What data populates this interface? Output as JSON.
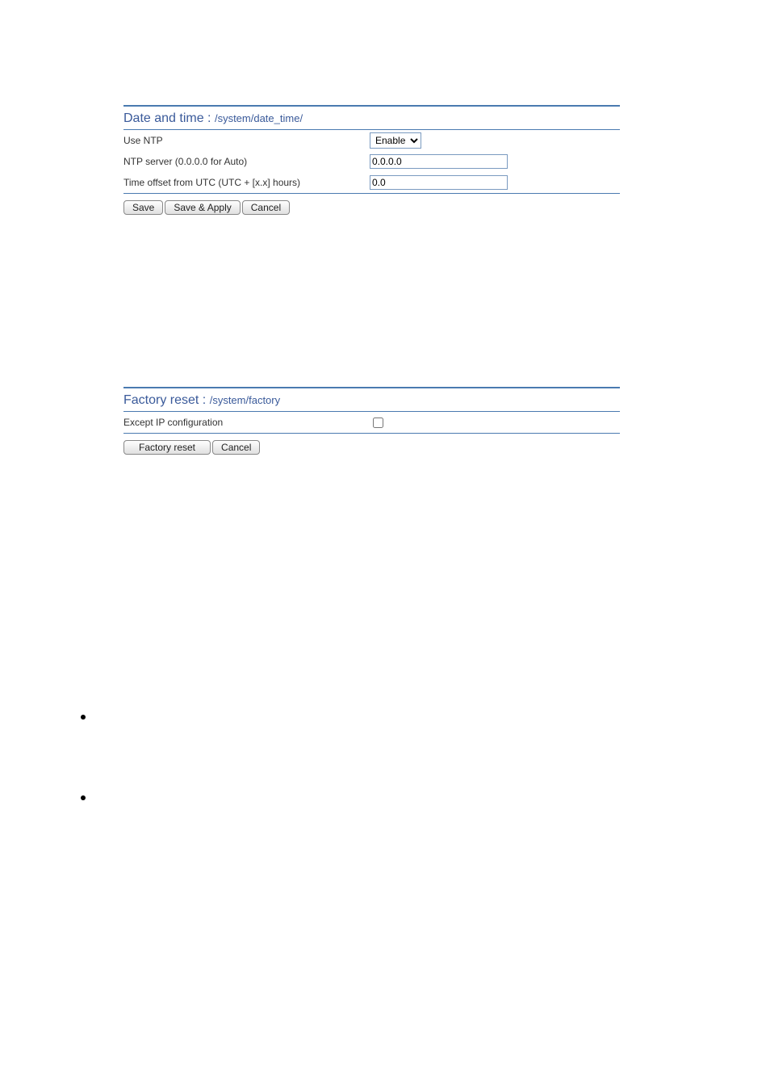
{
  "datetime": {
    "title": "Date and time :",
    "breadcrumb": "/system/date_time/",
    "rows": {
      "use_ntp_label": "Use NTP",
      "ntp_server_label": "NTP server (0.0.0.0 for Auto)",
      "time_offset_label": "Time offset from UTC (UTC + [x.x] hours)"
    },
    "values": {
      "use_ntp_selected": "Enable",
      "ntp_server": "0.0.0.0",
      "time_offset": "0.0"
    },
    "buttons": {
      "save": "Save",
      "save_apply": "Save & Apply",
      "cancel": "Cancel"
    }
  },
  "factory": {
    "title": "Factory reset :",
    "breadcrumb": "/system/factory",
    "rows": {
      "except_ip_label": "Except IP configuration"
    },
    "values": {
      "except_ip_checked": false
    },
    "buttons": {
      "factory_reset": "Factory reset",
      "cancel": "Cancel"
    }
  }
}
